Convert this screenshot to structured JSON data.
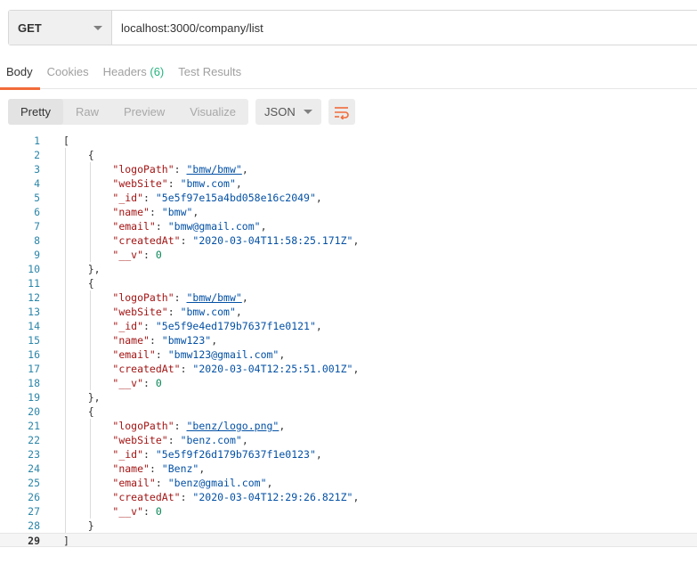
{
  "request": {
    "method": "GET",
    "url": "localhost:3000/company/list"
  },
  "response_tabs": [
    {
      "label": "Body",
      "active": true
    },
    {
      "label": "Cookies",
      "active": false
    },
    {
      "label": "Headers",
      "count": "(6)",
      "active": false
    },
    {
      "label": "Test Results",
      "active": false
    }
  ],
  "view_modes": [
    "Pretty",
    "Raw",
    "Preview",
    "Visualize"
  ],
  "selected_view": "Pretty",
  "format": "JSON",
  "icons": {
    "method_dropdown": "chevron-down-icon",
    "format_dropdown": "chevron-down-icon",
    "wrap": "wrap-lines-icon"
  },
  "colors": {
    "accent": "#f26b3a",
    "header_count": "#26b47f",
    "line_number": "#2b86a8",
    "json_key": "#a31515",
    "json_string": "#0451a5",
    "json_number": "#098658"
  },
  "response_body": [
    {
      "logoPath": "bmw/bmw",
      "webSite": "bmw.com",
      "_id": "5e5f97e15a4bd058e16c2049",
      "name": "bmw",
      "email": "bmw@gmail.com",
      "createdAt": "2020-03-04T11:58:25.171Z",
      "__v": 0
    },
    {
      "logoPath": "bmw/bmw",
      "webSite": "bmw.com",
      "_id": "5e5f9e4ed179b7637f1e0121",
      "name": "bmw123",
      "email": "bmw123@gmail.com",
      "createdAt": "2020-03-04T12:25:51.001Z",
      "__v": 0
    },
    {
      "logoPath": "benz/logo.png",
      "webSite": "benz.com",
      "_id": "5e5f9f26d179b7637f1e0123",
      "name": "Benz",
      "email": "benz@gmail.com",
      "createdAt": "2020-03-04T12:29:26.821Z",
      "__v": 0
    }
  ]
}
